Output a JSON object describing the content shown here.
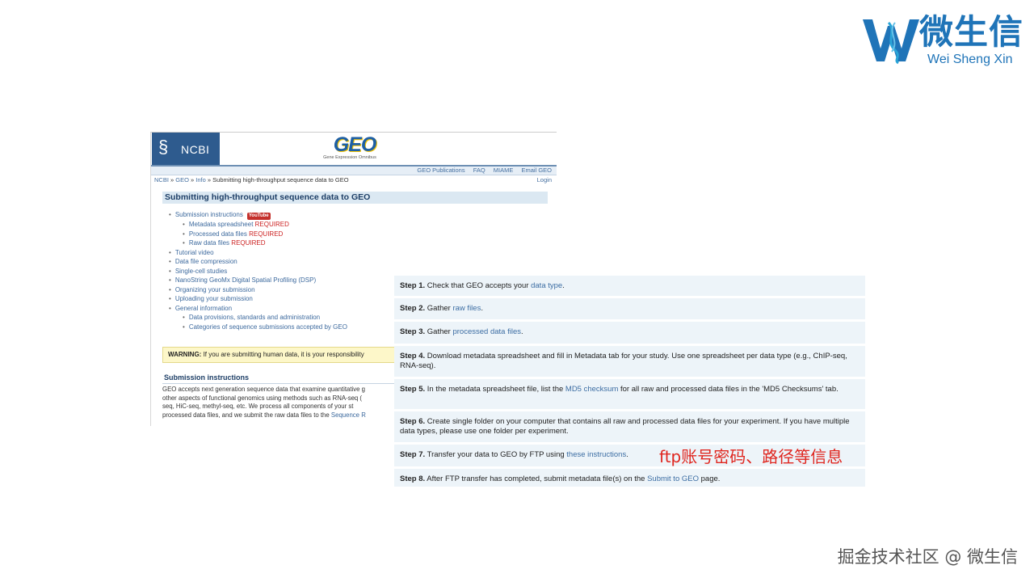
{
  "brand": {
    "name_cn": "微生信",
    "name_en": "Wei Sheng Xin",
    "color": "#1f74b8"
  },
  "geo_page": {
    "ncbi_logo": "NCBI",
    "geo_logo": "GEO",
    "geo_logo_sub": "Gene Expression Omnibus",
    "nav": [
      "GEO Publications",
      "FAQ",
      "MIAME",
      "Email GEO"
    ],
    "breadcrumb": {
      "ncbi": "NCBI",
      "geo": "GEO",
      "info": "Info",
      "current": "Submitting high-throughput sequence data to GEO",
      "login": "Login"
    },
    "title": "Submitting high-throughput sequence data to GEO",
    "toc": {
      "submission_instructions": "Submission instructions",
      "youtube": "YouTube",
      "metadata": "Metadata spreadsheet",
      "processed": "Processed data files",
      "raw": "Raw data files",
      "required": "REQUIRED",
      "tutorial": "Tutorial video",
      "compression": "Data file compression",
      "single_cell": "Single-cell studies",
      "nanostring": "NanoString GeoMx Digital Spatial Profiling (DSP)",
      "organizing": "Organizing your submission",
      "uploading": "Uploading your submission",
      "general": "General information",
      "provisions": "Data provisions, standards and administration",
      "categories": "Categories of sequence submissions accepted by GEO"
    },
    "warning_label": "WARNING:",
    "warning_text": "If you are submitting human data, it is your responsibility",
    "section_title": "Submission instructions",
    "para_lines": [
      "GEO accepts next generation sequence data that examine quantitative g",
      "other aspects of functional genomics using methods such as RNA-seq (",
      "seq, HiC-seq, methyl-seq, etc. We process all components of your st",
      "processed data files, and we submit the raw data files to the "
    ],
    "para_link": "Sequence R"
  },
  "steps": [
    {
      "label": "Step 1.",
      "before": "Check that GEO accepts your ",
      "link": "data type",
      "after": "."
    },
    {
      "label": "Step 2.",
      "before": "Gather ",
      "link": "raw files",
      "after": "."
    },
    {
      "label": "Step 3.",
      "before": "Gather ",
      "link": "processed data files",
      "after": "."
    },
    {
      "label": "Step 4.",
      "before": "Download metadata spreadsheet and fill in Metadata tab for your study. Use one spreadsheet per data type (e.g., ChIP-seq, RNA-seq).",
      "link": "",
      "after": ""
    },
    {
      "label": "Step 5.",
      "before": "In the metadata spreadsheet file, list the ",
      "link": "MD5 checksum",
      "after": " for all raw and processed data files in the 'MD5 Checksums' tab."
    },
    {
      "label": "Step 6.",
      "before": "Create single folder on your computer that contains all raw and processed data files for your experiment. If you have multiple data types, please use one folder per experiment.",
      "link": "",
      "after": ""
    },
    {
      "label": "Step 7.",
      "before": "Transfer your data to GEO by FTP using ",
      "link": "these instructions",
      "after": "."
    },
    {
      "label": "Step 8.",
      "before": "After FTP transfer has completed, submit metadata file(s) on the ",
      "link": "Submit to GEO",
      "after": " page."
    }
  ],
  "annotation": "ftp账号密码、路径等信息",
  "watermark": "掘金技术社区 @ 微生信"
}
